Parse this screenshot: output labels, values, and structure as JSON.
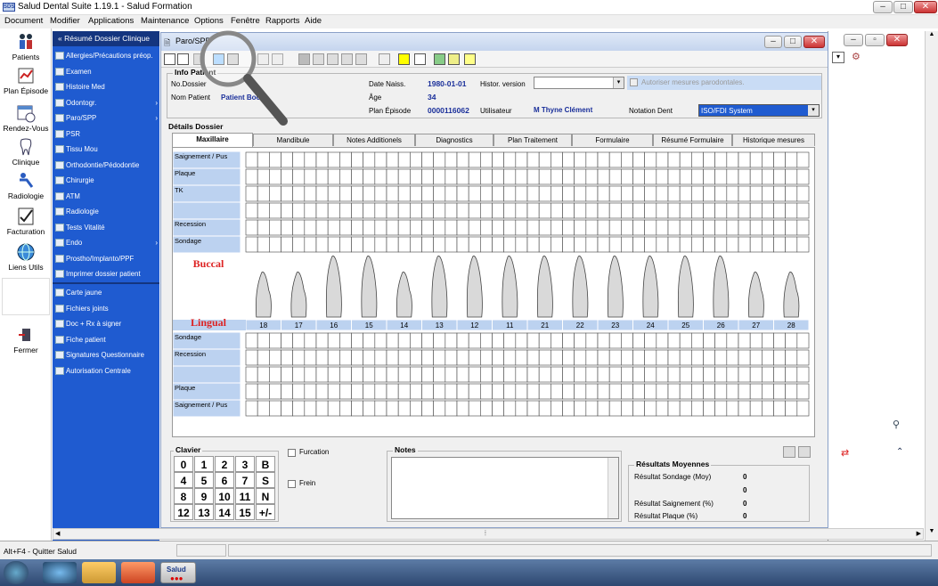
{
  "window": {
    "title": "Salud Dental Suite 1.19.1 - Salud Formation",
    "icon_text": "SDS"
  },
  "menu": [
    "Document",
    "Modifier",
    "Applications",
    "Maintenance",
    "Options",
    "Fenêtre",
    "Rapports",
    "Aide"
  ],
  "left_toolbar": [
    {
      "label": "Patients",
      "icon": "patients-icon"
    },
    {
      "label": "Plan Épisode",
      "icon": "plan-episode-icon"
    },
    {
      "label": "Rendez-Vous",
      "icon": "calendar-icon"
    },
    {
      "label": "Clinique",
      "icon": "tooth-icon"
    },
    {
      "label": "Radiologie",
      "icon": "radiology-icon"
    },
    {
      "label": "Facturation",
      "icon": "invoice-icon"
    },
    {
      "label": "Liens Utils",
      "icon": "globe-icon"
    },
    {
      "label": "Fermer",
      "icon": "exit-icon"
    }
  ],
  "blue_menu": {
    "header": "Résumé Dossier Clinique",
    "items": [
      {
        "label": "Allergies/Précautions préop.",
        "arrow": false
      },
      {
        "label": "Examen",
        "arrow": false
      },
      {
        "label": "Histoire Med",
        "arrow": false
      },
      {
        "label": "Odontogr.",
        "arrow": true
      },
      {
        "label": "Paro/SPP",
        "arrow": true
      },
      {
        "label": "PSR",
        "arrow": false
      },
      {
        "label": "Tissu Mou",
        "arrow": false
      },
      {
        "label": "Orthodontie/Pédodontie",
        "arrow": false
      },
      {
        "label": "Chirurgie",
        "arrow": false
      },
      {
        "label": "ATM",
        "arrow": false
      },
      {
        "label": "Radiologie",
        "arrow": false
      },
      {
        "label": "Tests Vitalité",
        "arrow": false
      },
      {
        "label": "Endo",
        "arrow": true
      },
      {
        "label": "Prostho/Implanto/PPF",
        "arrow": false
      },
      {
        "label": "Imprimer dossier patient",
        "arrow": false
      }
    ],
    "items2": [
      {
        "label": "Carte jaune"
      },
      {
        "label": "Fichiers joints"
      },
      {
        "label": "Doc + Rx à signer"
      },
      {
        "label": "Fiche patient"
      },
      {
        "label": "Signatures Questionnaire"
      },
      {
        "label": "Autorisation Centrale"
      }
    ]
  },
  "dialog": {
    "title": "Paro/SPP",
    "info_title": "Info Patient",
    "no_dossier_label": "No.Dossier",
    "nom_patient_label": "Nom Patient",
    "nom_patient_value": "Patient Book",
    "date_naiss_label": "Date Naiss.",
    "date_naiss_value": "1980-01-01",
    "age_label": "Âge",
    "age_value": "34",
    "plan_label": "Plan Épisode",
    "plan_value": "0000116062",
    "histor_label": "Histor. version",
    "utilisateur_label": "Utilisateur",
    "utilisateur_value": "M Thyne Clément",
    "notation_label": "Notation Dent",
    "notation_value": "ISO/FDI System",
    "autoriser_label": "Autoriser mesures parodontales.",
    "details_title": "Détails Dossier",
    "tabs": [
      "Maxillaire",
      "Mandibule",
      "Notes Additionels",
      "Diagnostics",
      "Plan Traitement",
      "Formulaire",
      "Résumé Formulaire",
      "Historique mesures"
    ],
    "top_rows": [
      "Saignement / Pus",
      "Plaque",
      "TK",
      "",
      "Recession",
      "Sondage"
    ],
    "bottom_rows": [
      "Sondage",
      "Recession",
      "",
      "Plaque",
      "Saignement / Pus"
    ],
    "buccal": "Buccal",
    "lingual": "Lingual",
    "teeth": [
      "18",
      "17",
      "16",
      "15",
      "14",
      "13",
      "12",
      "11",
      "21",
      "22",
      "23",
      "24",
      "25",
      "26",
      "27",
      "28"
    ],
    "clavier_title": "Clavier",
    "keys": [
      "0",
      "1",
      "2",
      "3",
      "B",
      "4",
      "5",
      "6",
      "7",
      "S",
      "8",
      "9",
      "10",
      "11",
      "N",
      "12",
      "13",
      "14",
      "15",
      "+/-"
    ],
    "furcation": "Furcation",
    "frein": "Frein",
    "notes_title": "Notes",
    "resultats_title": "Résultats Moyennes",
    "resultats": [
      {
        "label": "Résultat Sondage (Moy)",
        "value": "0"
      },
      {
        "label": "",
        "value": "0"
      },
      {
        "label": "Résultat Saignement (%)",
        "value": "0"
      },
      {
        "label": "Résultat Plaque (%)",
        "value": "0"
      }
    ]
  },
  "statusbar": {
    "text": "Alt+F4 - Quitter Salud"
  },
  "taskbar": {
    "active_label": "Salud"
  }
}
